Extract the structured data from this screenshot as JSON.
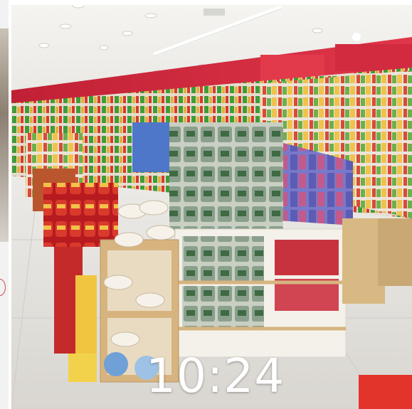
{
  "photo": {
    "subject": "supermarket-snack-aisle",
    "colors": {
      "ceiling": "#f4f3ef",
      "floor": "#e3e1dd",
      "signage_red": "#d3243c",
      "shelf_wood": "#d7b47f"
    }
  },
  "overlay": {
    "time": "10:24"
  }
}
